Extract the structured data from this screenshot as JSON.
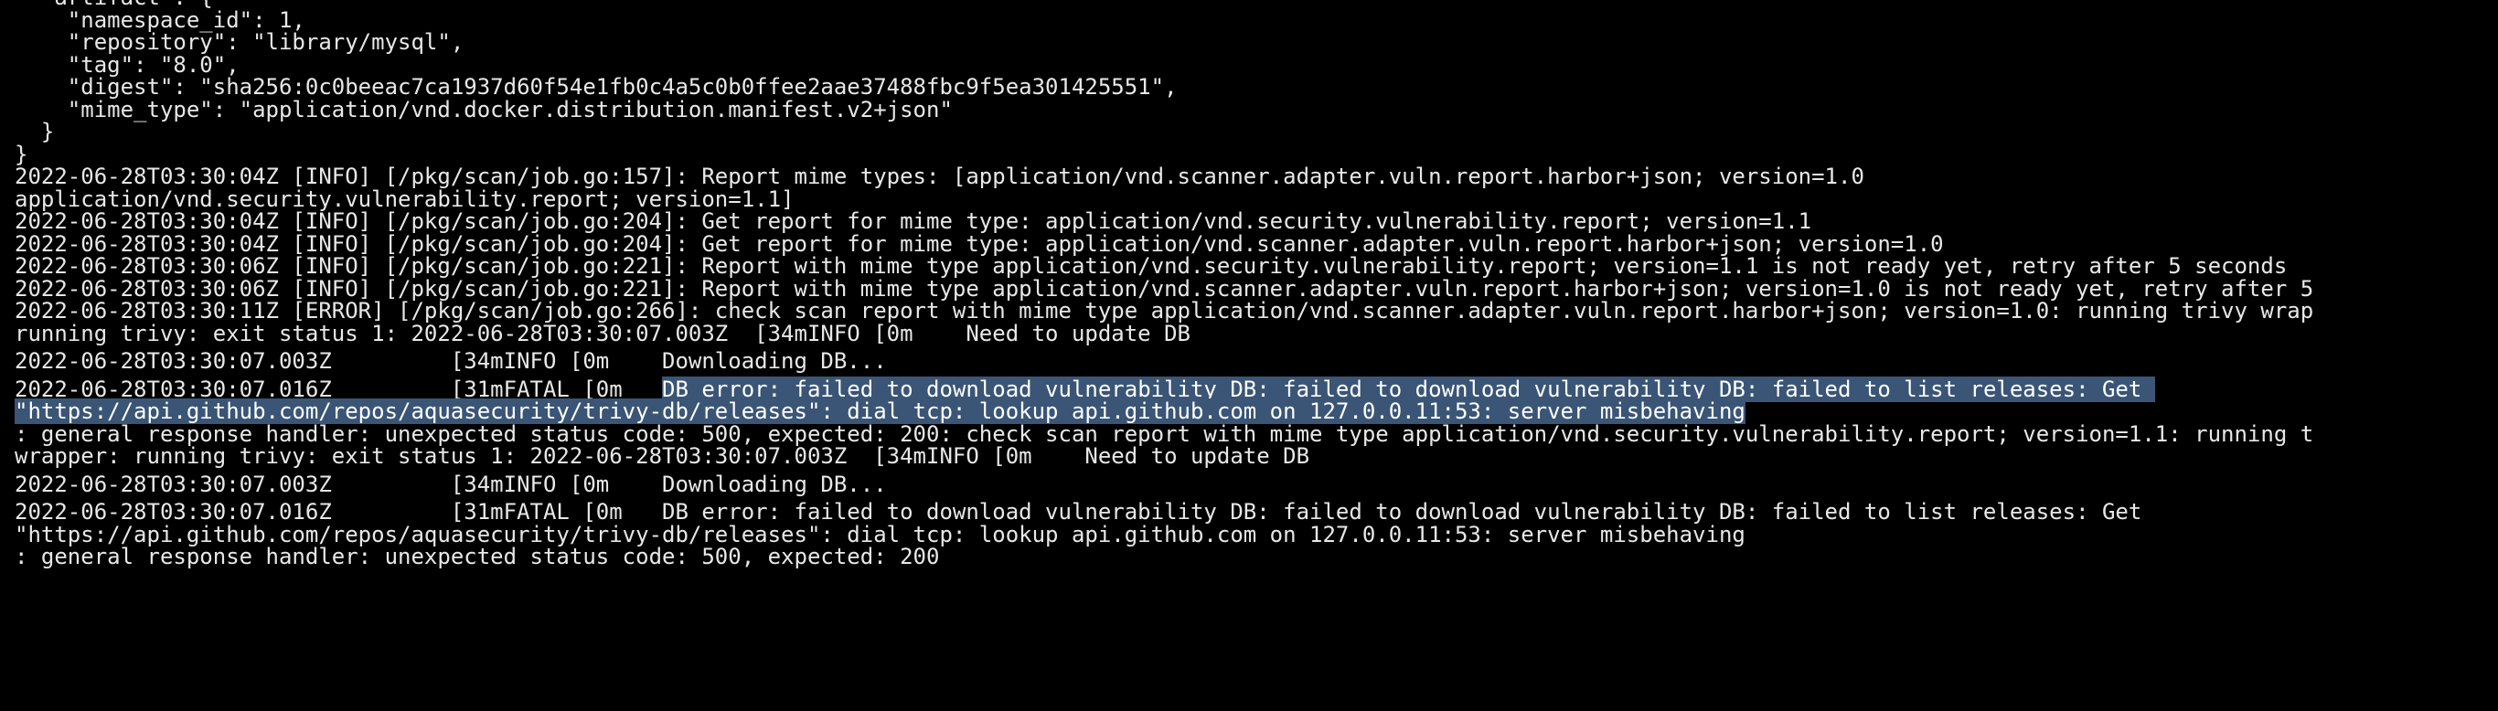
{
  "terminal": {
    "lines": [
      "  \"artifact\": {",
      "    \"namespace_id\": 1,",
      "    \"repository\": \"library/mysql\",",
      "    \"tag\": \"8.0\",",
      "    \"digest\": \"sha256:0c0beeac7ca1937d60f54e1fb0c4a5c0b0ffee2aae37488fbc9f5ea301425551\",",
      "    \"mime_type\": \"application/vnd.docker.distribution.manifest.v2+json\"",
      "  }",
      "}",
      "2022-06-28T03:30:04Z [INFO] [/pkg/scan/job.go:157]: Report mime types: [application/vnd.scanner.adapter.vuln.report.harbor+json; version=1.0",
      "application/vnd.security.vulnerability.report; version=1.1]",
      "2022-06-28T03:30:04Z [INFO] [/pkg/scan/job.go:204]: Get report for mime type: application/vnd.security.vulnerability.report; version=1.1",
      "2022-06-28T03:30:04Z [INFO] [/pkg/scan/job.go:204]: Get report for mime type: application/vnd.scanner.adapter.vuln.report.harbor+json; version=1.0",
      "2022-06-28T03:30:06Z [INFO] [/pkg/scan/job.go:221]: Report with mime type application/vnd.security.vulnerability.report; version=1.1 is not ready yet, retry after 5 seconds",
      "2022-06-28T03:30:06Z [INFO] [/pkg/scan/job.go:221]: Report with mime type application/vnd.scanner.adapter.vuln.report.harbor+json; version=1.0 is not ready yet, retry after 5",
      "2022-06-28T03:30:11Z [ERROR] [/pkg/scan/job.go:266]: check scan report with mime type application/vnd.scanner.adapter.vuln.report.harbor+json; version=1.0: running trivy wrap",
      "running trivy: exit status 1: 2022-06-28T03:30:07.003Z  [34mINFO [0m    Need to update DB",
      "2022-06-28T03:30:07.003Z         [34mINFO [0m    Downloading DB...",
      "2022-06-28T03:30:07.016Z         [31mFATAL [0m   ",
      "DB error: failed to download vulnerability DB: failed to download vulnerability DB: failed to list releases: Get ",
      "\"https://api.github.com/repos/aquasecurity/trivy-db/releases\": dial tcp: lookup api.github.com on 127.0.0.11:53: server misbehaving",
      ": general response handler: unexpected status code: 500, expected: 200: check scan report with mime type application/vnd.security.vulnerability.report; version=1.1: running t",
      "wrapper: running trivy: exit status 1: 2022-06-28T03:30:07.003Z  [34mINFO [0m    Need to update DB",
      "2022-06-28T03:30:07.003Z         [34mINFO [0m    Downloading DB...",
      "2022-06-28T03:30:07.016Z         [31mFATAL [0m   DB error: failed to download vulnerability DB: failed to download vulnerability DB: failed to list releases: Get",
      "\"https://api.github.com/repos/aquasecurity/trivy-db/releases\": dial tcp: lookup api.github.com on 127.0.0.11:53: server misbehaving",
      ": general response handler: unexpected status code: 500, expected: 200"
    ]
  },
  "colors": {
    "background": "#000000",
    "text": "#e8e8e8",
    "selection": "#3a5575"
  }
}
